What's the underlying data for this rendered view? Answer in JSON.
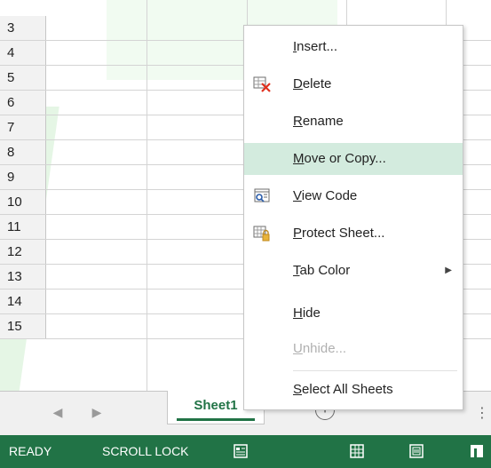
{
  "rows": [
    "3",
    "4",
    "5",
    "6",
    "7",
    "8",
    "9",
    "10",
    "11",
    "12",
    "13",
    "14",
    "15"
  ],
  "context_menu": {
    "items": [
      {
        "key": "I",
        "rest": "nsert...",
        "enabled": true,
        "icon": null
      },
      {
        "key": "D",
        "rest": "elete",
        "enabled": true,
        "icon": "delete-sheet-icon"
      },
      {
        "key": "R",
        "rest": "ename",
        "enabled": true,
        "icon": null
      },
      {
        "key": "M",
        "rest": "ove or Copy...",
        "enabled": true,
        "icon": null,
        "highlighted": true
      },
      {
        "key": "V",
        "rest": "iew Code",
        "enabled": true,
        "icon": "view-code-icon"
      },
      {
        "key": "P",
        "rest": "rotect Sheet...",
        "enabled": true,
        "icon": "protect-sheet-icon"
      },
      {
        "key": "T",
        "rest": "ab Color",
        "enabled": true,
        "icon": null,
        "submenu": true
      },
      {
        "key": "H",
        "rest": "ide",
        "enabled": true,
        "icon": null
      },
      {
        "key": "U",
        "rest": "nhide...",
        "enabled": false,
        "icon": null
      },
      {
        "key": "S",
        "rest": "elect All Sheets",
        "enabled": true,
        "icon": null
      }
    ],
    "submenu_arrow": "▶"
  },
  "tabs": {
    "active_sheet": "Sheet1",
    "add_sheet_label": "+",
    "prev_arrow": "◀",
    "next_arrow": "▶",
    "more": "⋮"
  },
  "status": {
    "ready": "READY",
    "scroll_lock": "SCROLL LOCK"
  },
  "colors": {
    "status_bar": "#217346",
    "menu_highlight": "#d3ebde",
    "sheet_tab_text": "#217346"
  }
}
